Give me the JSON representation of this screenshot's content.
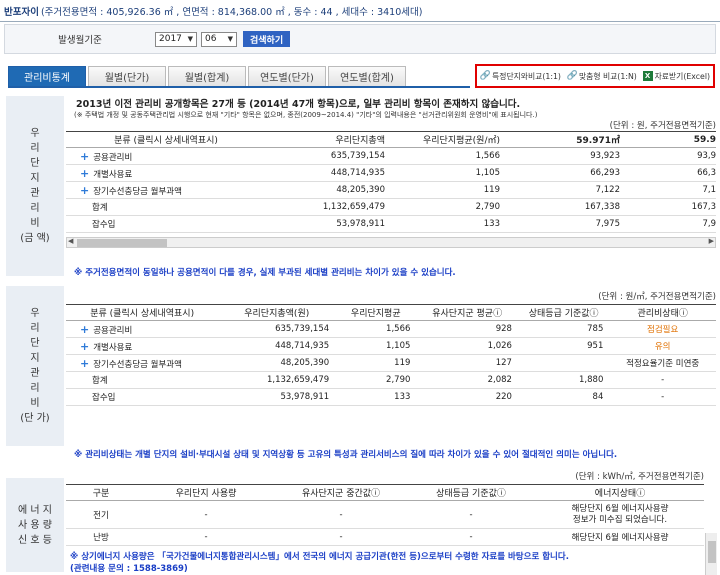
{
  "header": {
    "name": "반포자이",
    "info": "(주거전용면적 : 405,926.36 ㎡ , 연면적 : 814,368.00 ㎡ , 동수 : 44 , 세대수 : 3410세대)"
  },
  "control": {
    "label": "발생월기준",
    "year": "2017",
    "month": "06",
    "search": "검색하기"
  },
  "tabs": [
    "관리비통계",
    "월별(단가)",
    "월별(합계)",
    "연도별(단가)",
    "연도별(합계)"
  ],
  "tools": {
    "compare1": "특정단지와비교(1:1)",
    "compare2": "맞춤형 비교(1:N)",
    "excel": "자료받기(Excel)",
    "excel_icon": "X"
  },
  "section1": {
    "side": [
      "우",
      "리",
      "단",
      "지",
      "관",
      "리",
      "비",
      "(금 액)"
    ],
    "title": "2013년 이전 관리비 공개항목은 27개 등 (2014년 47개 항목)으로, 일부 관리비 항목이 존재하지 않습니다.",
    "note": "(※ 주택법 개정 및 공동주택관리법 시행으로 현재 \"기타\" 항목은 없으며, 종전(2009~2014.4) \"기타\"의 입력내용은 \"선거관리위원회 운영비\"에 표시됩니다.)",
    "unit": "(단위 : 원, 주거전용면적기준)",
    "columns": [
      "분류 (클릭시 상세내역표시)",
      "우리단지총액",
      "우리단지평균(원/㎡)",
      "59.971㎡",
      "59.9"
    ],
    "rows": [
      {
        "label": "공용관리비",
        "plus": "+",
        "v": [
          "635,739,154",
          "1,566",
          "93,923",
          "93,9"
        ]
      },
      {
        "label": "개별사용료",
        "plus": "+",
        "v": [
          "448,714,935",
          "1,105",
          "66,293",
          "66,3"
        ]
      },
      {
        "label": "장기수선충당금 월부과액",
        "plus": "+",
        "v": [
          "48,205,390",
          "119",
          "7,122",
          "7,1"
        ]
      },
      {
        "label": "합계",
        "plus": "",
        "v": [
          "1,132,659,479",
          "2,790",
          "167,338",
          "167,3"
        ]
      },
      {
        "label": "잡수입",
        "plus": "",
        "v": [
          "53,978,911",
          "133",
          "7,975",
          "7,9"
        ]
      }
    ],
    "warn": "※ 주거전용면적이 동일하나 공용면적이 다를 경우, 실제 부과된 세대별 관리비는 차이가 있을 수 있습니다."
  },
  "section2": {
    "side": [
      "우",
      "리",
      "단",
      "지",
      "관",
      "리",
      "비",
      "(단 가)"
    ],
    "unit": "(단위 : 원/㎡, 주거전용면적기준)",
    "columns": [
      "분류 (클릭시 상세내역표시)",
      "우리단지총액(원)",
      "우리단지평균",
      "유사단지군 평균ⓘ",
      "상태등급 기준값ⓘ",
      "관리비상태ⓘ"
    ],
    "rows": [
      {
        "label": "공용관리비",
        "plus": "+",
        "v": [
          "635,739,154",
          "1,566",
          "928",
          "785"
        ],
        "status": "점검필요",
        "orange": true
      },
      {
        "label": "개별사용료",
        "plus": "+",
        "v": [
          "448,714,935",
          "1,105",
          "1,026",
          "951"
        ],
        "status": "유의",
        "orange": true
      },
      {
        "label": "장기수선충당금 월부과액",
        "plus": "+",
        "v": [
          "48,205,390",
          "119",
          "127",
          ""
        ],
        "status": "적정요율기준 미연중",
        "orange": false
      },
      {
        "label": "합계",
        "plus": "",
        "v": [
          "1,132,659,479",
          "2,790",
          "2,082",
          "1,880"
        ],
        "status": "-",
        "orange": false
      },
      {
        "label": "잡수입",
        "plus": "",
        "v": [
          "53,978,911",
          "133",
          "220",
          "84"
        ],
        "status": "-",
        "orange": false
      }
    ],
    "warn": "※ 관리비상태는 개별 단지의 설비·부대시설 상태 및 지역상황 등 고유의 특성과 관리서비스의 질에 따라 차이가 있을 수 있어 절대적인 의미는 아닙니다."
  },
  "section3": {
    "side": [
      "에 너 지",
      "사 용 량",
      "신 호 등"
    ],
    "unit": "(단위 : kWh/㎡, 주거전용면적기준)",
    "columns": [
      "구분",
      "우리단지 사용량",
      "유사단지군 중간값ⓘ",
      "상태등급 기준값ⓘ",
      "에너지상태ⓘ"
    ],
    "rows": [
      {
        "label": "전기",
        "v": [
          "-",
          "-",
          "-"
        ],
        "status1": "해당단지 6월 에너지사용량",
        "status2": "정보가 미수집 되었습니다."
      },
      {
        "label": "난방",
        "v": [
          "-",
          "-",
          "-"
        ],
        "status1": "해당단지 6월 에너지사용량",
        "status2": ""
      }
    ],
    "warn": "※ 상기에너지 사용량은 「국가건물에너지통합관리시스템」에서 전국의 에너지 공급기관(한전 등)으로부터 수령한 자료를 바탕으로 합니다.",
    "contact": "(관련내용 문의 : 1588-3869)"
  },
  "colors": {
    "accent": "#1f6ab4",
    "warn": "#1b3fc6",
    "highlight": "#e00000",
    "orange": "#e07000"
  }
}
